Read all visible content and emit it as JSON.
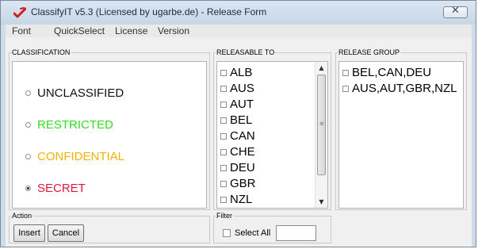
{
  "window": {
    "title": "ClassifyIT v5.3 (Licensed by ugarbe.de) - Release Form",
    "close_icon_label": "✕"
  },
  "menu": [
    "Font",
    "QuickSelect",
    "License",
    "Version"
  ],
  "classification": {
    "legend": "CLASSIFICATION",
    "options": [
      {
        "label": "UNCLASSIFIED",
        "color": "#111111",
        "selected": false
      },
      {
        "label": "RESTRICTED",
        "color": "#33dd22",
        "selected": false
      },
      {
        "label": "CONFIDENTIAL",
        "color": "#f2b200",
        "selected": false
      },
      {
        "label": "SECRET",
        "color": "#e2163c",
        "selected": true
      }
    ]
  },
  "releasable_to": {
    "legend": "RELEASABLE TO",
    "items": [
      "ALB",
      "AUS",
      "AUT",
      "BEL",
      "CAN",
      "CHE",
      "DEU",
      "GBR",
      "NZL"
    ]
  },
  "release_group": {
    "legend": "RELEASE GROUP",
    "items": [
      "BEL,CAN,DEU",
      "AUS,AUT,GBR,NZL"
    ]
  },
  "action": {
    "legend": "Action",
    "insert_label": "Insert",
    "cancel_label": "Cancel"
  },
  "filter": {
    "legend": "Filter",
    "select_all_label": "Select All",
    "value": ""
  }
}
